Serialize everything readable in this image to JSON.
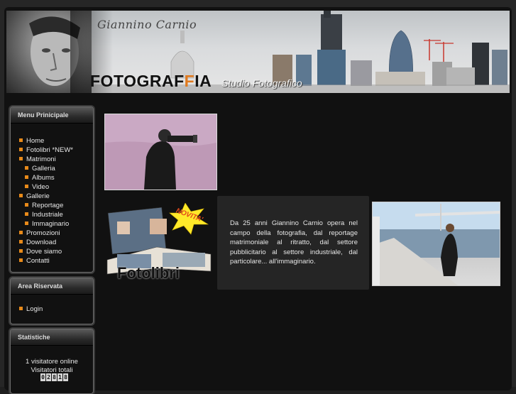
{
  "header": {
    "script_name": "Giannino Carnio",
    "brand_part1": "FOTOGRAF",
    "brand_accent": "F",
    "brand_part2": "IA",
    "tagline": "Studio Fotografico"
  },
  "menu": {
    "title": "Menu Prinicipale",
    "items": [
      {
        "label": "Home",
        "level": 0
      },
      {
        "label": "Fotolibri *NEW*",
        "level": 0
      },
      {
        "label": "Matrimoni",
        "level": 0
      },
      {
        "label": "Galleria",
        "level": 1
      },
      {
        "label": "Albums",
        "level": 1
      },
      {
        "label": "Video",
        "level": 1
      },
      {
        "label": "Gallerie",
        "level": 0
      },
      {
        "label": "Reportage",
        "level": 1
      },
      {
        "label": "Industriale",
        "level": 1
      },
      {
        "label": "Immaginario",
        "level": 1
      },
      {
        "label": "Promozioni",
        "level": 0
      },
      {
        "label": "Download",
        "level": 0
      },
      {
        "label": "Dove siamo",
        "level": 0
      },
      {
        "label": "Contatti",
        "level": 0
      }
    ]
  },
  "reserved": {
    "title": "Area Riservata",
    "login_label": "Login"
  },
  "stats": {
    "title": "Statistiche",
    "online_text": "1 visitatore online",
    "total_label": "Visitatori totali",
    "counter_digits": [
      "0",
      "2",
      "8",
      "1",
      "8"
    ]
  },
  "promo": {
    "badge_text": "NOVITA'",
    "book_title": "Fotolibri"
  },
  "description": "Da 25 anni Giannino Carnio opera nel campo della fotografia, dal reportage matrimoniale al ritratto, dal settore pubblicitario al settore industriale, dal particolare... all'immaginario.",
  "colors": {
    "accent": "#e88a1a",
    "background": "#1f1f1f",
    "panel": "#111111"
  }
}
